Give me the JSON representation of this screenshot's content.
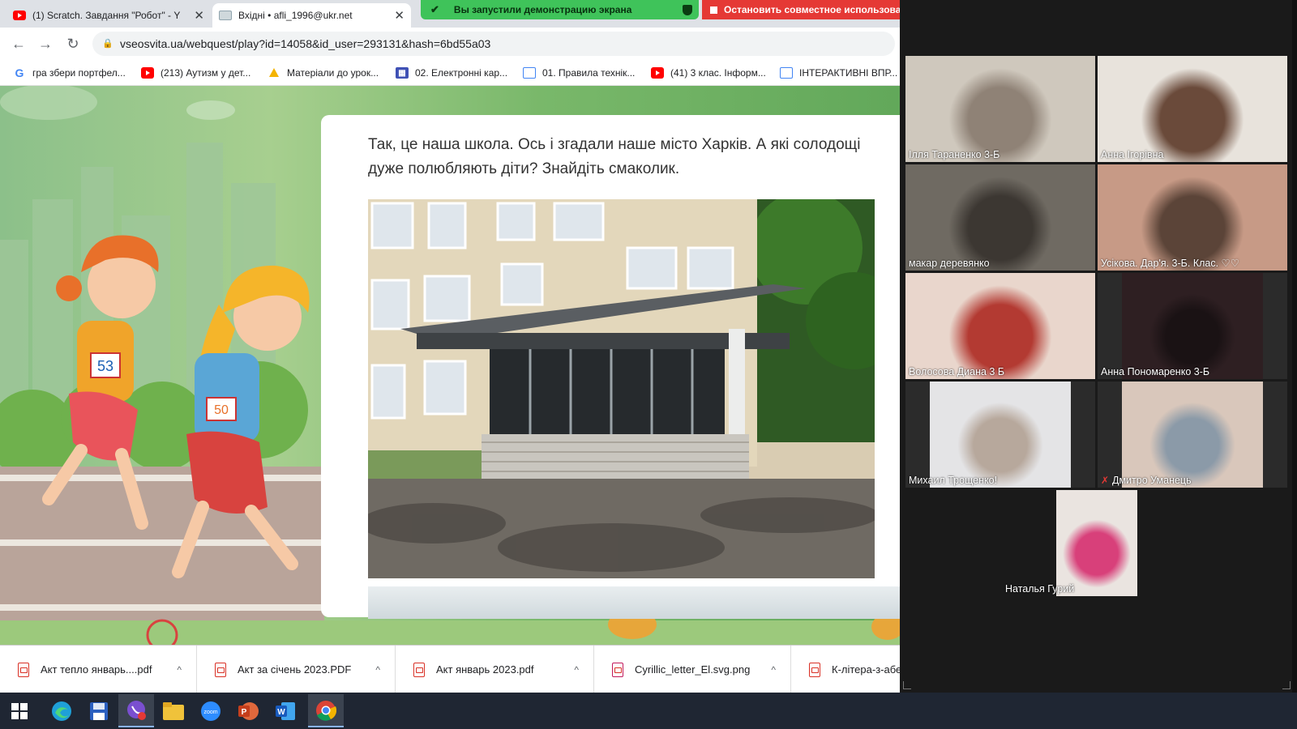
{
  "browser": {
    "tabs": [
      {
        "title": "(1) Scratch. Завдання \"Робот\" - Y",
        "icon": "youtube-icon"
      },
      {
        "title": "Вхідні • afli_1996@ukr.net",
        "icon": "mail-icon"
      }
    ],
    "share_bar": {
      "message": "Вы запустили демонстрацию экрана",
      "stop_label": "Остановить совместное использован"
    },
    "url": "vseosvita.ua/webquest/play?id=14058&id_user=293131&hash=6bd55a03",
    "bookmarks": [
      {
        "label": "гра збери портфел...",
        "icon": "google-icon"
      },
      {
        "label": "(213) Аутизм у дет...",
        "icon": "youtube-icon"
      },
      {
        "label": "Матеріали до урок...",
        "icon": "drive-icon"
      },
      {
        "label": "02. Електронні кар...",
        "icon": "app-icon"
      },
      {
        "label": "01. Правила технік...",
        "icon": "page-icon"
      },
      {
        "label": "(41) 3 клас. Інформ...",
        "icon": "youtube-icon"
      },
      {
        "label": "ІНТЕРАКТИВНІ ВПР...",
        "icon": "page-icon"
      }
    ],
    "content": {
      "text": "Так, це наша школа. Ось і згадали наше місто Харків. А які солодощі дуже полюбляють діти? Знайдіть смаколик.",
      "bib_numbers": [
        "53",
        "50"
      ]
    },
    "downloads": [
      "Акт тепло январь....pdf",
      "Акт за січень 2023.PDF",
      "Акт январь 2023.pdf",
      "Cyrillic_letter_El.svg.png",
      "К-літера-з-абе"
    ]
  },
  "zoom": {
    "participants": [
      {
        "name": "Ілля Тараненко 3-Б",
        "colors": [
          "#cfc8bd",
          "#8f8276"
        ]
      },
      {
        "name": "Анна Ігорівна",
        "colors": [
          "#e8e3dc",
          "#6a4a3a"
        ]
      },
      {
        "name": "макар  деревянко",
        "colors": [
          "#6f6a62",
          "#3c3732"
        ]
      },
      {
        "name": "Усікова. Дар'я. 3-Б. Клас. ♡♡",
        "colors": [
          "#c79a86",
          "#5b4438"
        ],
        "active": true
      },
      {
        "name": "Волосова Диана 3 Б",
        "colors": [
          "#e9d6cc",
          "#b33a32"
        ]
      },
      {
        "name": "Анна Пономаренко 3-Б",
        "colors": [
          "#2e1f22",
          "#1a1214"
        ]
      },
      {
        "name": "Михаил Трощенко!",
        "colors": [
          "#e4e4e6",
          "#b7a89c"
        ]
      },
      {
        "name": "Дмитро Уманець",
        "colors": [
          "#d9c7bb",
          "#8b9aa8"
        ],
        "muted": true
      },
      {
        "name": "Наталья Гурий",
        "colors": [
          "#eae4e0",
          "#d8407a"
        ]
      }
    ]
  },
  "taskbar": {
    "apps": [
      "windows-start-icon",
      "edge-icon",
      "floppy-icon",
      "viber-icon",
      "explorer-icon",
      "zoom-icon",
      "powerpoint-icon",
      "word-icon",
      "chrome-icon"
    ]
  },
  "colors": {
    "share_green": "#3fc35a",
    "share_red": "#e53935",
    "active_tile": "#e3e38a",
    "taskbar": "#1f2633"
  }
}
